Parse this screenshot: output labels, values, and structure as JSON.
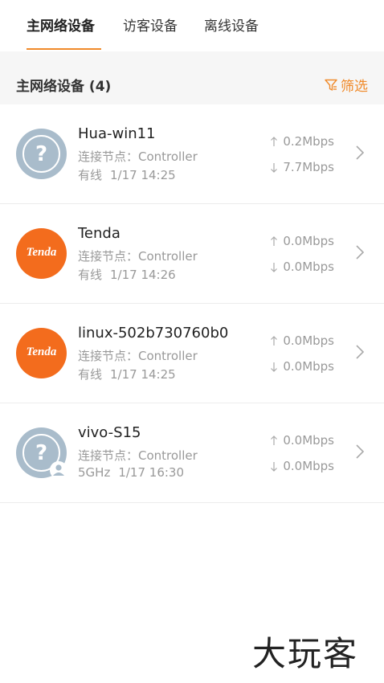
{
  "tabs": [
    {
      "label": "主网络设备",
      "active": true
    },
    {
      "label": "访客设备",
      "active": false
    },
    {
      "label": "离线设备",
      "active": false
    }
  ],
  "section": {
    "title": "主网络设备 (4)",
    "filter_label": "筛选"
  },
  "colors": {
    "accent": "#f08a2a",
    "tenda": "#f36c1d",
    "unknown_avatar": "#a9bccb"
  },
  "devices": [
    {
      "name": "Hua-win11",
      "node": "连接节点：Controller",
      "conn_type": "有线",
      "time": "1/17 14:25",
      "up": "0.2Mbps",
      "down": "7.7Mbps",
      "avatar": "unknown-device-icon"
    },
    {
      "name": "Tenda",
      "node": "连接节点：Controller",
      "conn_type": "有线",
      "time": "1/17 14:26",
      "up": "0.0Mbps",
      "down": "0.0Mbps",
      "avatar": "tenda-logo",
      "brand": "Tenda"
    },
    {
      "name": "linux-502b730760b0",
      "node": "连接节点：Controller",
      "conn_type": "有线",
      "time": "1/17 14:25",
      "up": "0.0Mbps",
      "down": "0.0Mbps",
      "avatar": "tenda-logo",
      "brand": "Tenda"
    },
    {
      "name": "vivo-S15",
      "node": "连接节点：Controller",
      "conn_type": "5GHz",
      "time": "1/17 16:30",
      "up": "0.0Mbps",
      "down": "0.0Mbps",
      "avatar": "unknown-device-icon"
    }
  ],
  "watermark": "大玩客"
}
